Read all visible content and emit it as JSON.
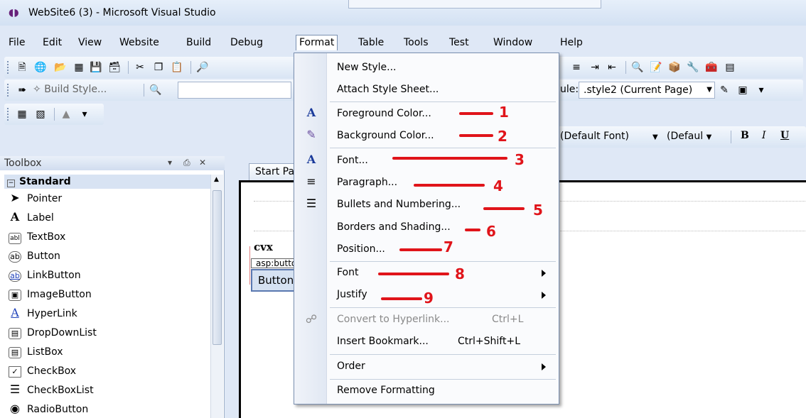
{
  "window": {
    "title": "WebSite6 (3) - Microsoft Visual Studio"
  },
  "menubar": [
    "File",
    "Edit",
    "View",
    "Website",
    "Build",
    "Debug",
    "Format",
    "Table",
    "Tools",
    "Test",
    "Window",
    "Help"
  ],
  "menubar_active": "Format",
  "toolbar2": {
    "build_style_label": "Build Style...",
    "rule_label": "ule:",
    "rule_value": ".style2 (Current Page)"
  },
  "toolbar3": {
    "font_name": "(Default Font)",
    "font_size": "(Defaul",
    "bold": "B",
    "italic": "I",
    "underline": "U"
  },
  "toolbox": {
    "title": "Toolbox",
    "pin": "− Ṙ",
    "category": "Standard",
    "items": [
      {
        "label": "Pointer",
        "icon": "▲"
      },
      {
        "label": "Label",
        "icon": "A"
      },
      {
        "label": "TextBox",
        "icon": "abl"
      },
      {
        "label": "Button",
        "icon": "ab"
      },
      {
        "label": "LinkButton",
        "icon": "ab"
      },
      {
        "label": "ImageButton",
        "icon": "▣"
      },
      {
        "label": "HyperLink",
        "icon": "A"
      },
      {
        "label": "DropDownList",
        "icon": "▤"
      },
      {
        "label": "ListBox",
        "icon": "▤"
      },
      {
        "label": "CheckBox",
        "icon": "✓"
      },
      {
        "label": "CheckBoxList",
        "icon": "☰"
      },
      {
        "label": "RadioButton",
        "icon": "◉"
      }
    ]
  },
  "editor": {
    "tab_label": "Start Page",
    "text": "cvx",
    "asp_tag": "asp:button",
    "button_label": "Button"
  },
  "format_menu": [
    {
      "label": "New Style..."
    },
    {
      "label": "Attach Style Sheet..."
    },
    {
      "label": "Foreground Color...",
      "annotation": "1"
    },
    {
      "label": "Background Color...",
      "annotation": "2"
    },
    {
      "label": "Font...",
      "annotation": "3"
    },
    {
      "label": "Paragraph...",
      "annotation": "4"
    },
    {
      "label": "Bullets and Numbering...",
      "annotation": "5"
    },
    {
      "label": "Borders and Shading...",
      "annotation": "6"
    },
    {
      "label": "Position...",
      "annotation": "7"
    },
    {
      "label": "Font",
      "annotation": "8",
      "submenu": true
    },
    {
      "label": "Justify",
      "annotation": "9",
      "submenu": true
    },
    {
      "label": "Convert to Hyperlink...",
      "shortcut": "Ctrl+L",
      "disabled": true
    },
    {
      "label": "Insert Bookmark...",
      "shortcut": "Ctrl+Shift+L"
    },
    {
      "label": "Order",
      "submenu": true
    },
    {
      "label": "Remove Formatting"
    }
  ],
  "colors": {
    "annotation": "#e0141a",
    "menu_border": "#7a8fb0",
    "ide_background": "#dfe8f6"
  }
}
